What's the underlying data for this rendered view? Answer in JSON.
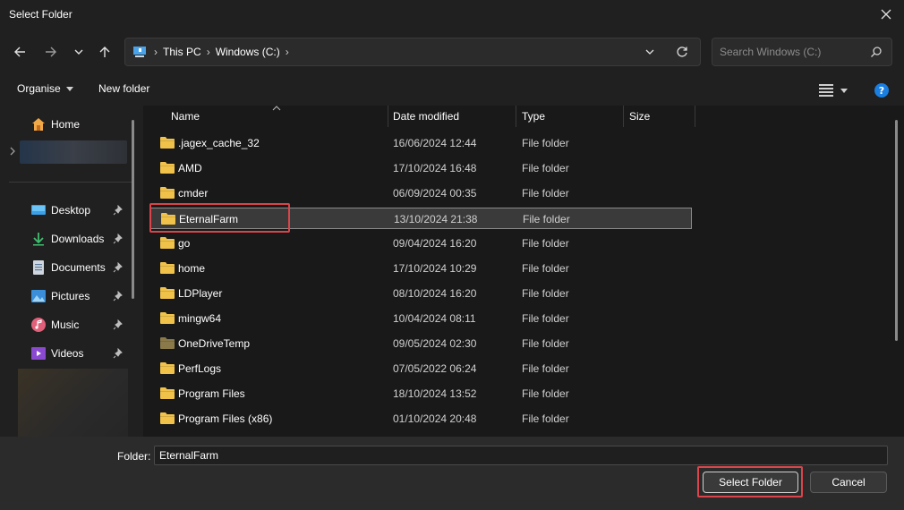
{
  "window": {
    "title": "Select Folder"
  },
  "nav": {
    "breadcrumb": [
      "This PC",
      "Windows (C:)"
    ],
    "search_placeholder": "Search Windows (C:)"
  },
  "toolbar": {
    "organise": "Organise",
    "new_folder": "New folder"
  },
  "sidebar": {
    "home": "Home",
    "pinned": [
      {
        "label": "Desktop",
        "icon": "desktop-icon"
      },
      {
        "label": "Downloads",
        "icon": "downloads-icon"
      },
      {
        "label": "Documents",
        "icon": "documents-icon"
      },
      {
        "label": "Pictures",
        "icon": "pictures-icon"
      },
      {
        "label": "Music",
        "icon": "music-icon"
      },
      {
        "label": "Videos",
        "icon": "videos-icon"
      }
    ]
  },
  "columns": {
    "name": "Name",
    "date": "Date modified",
    "type": "Type",
    "size": "Size"
  },
  "files": [
    {
      "name": ".jagex_cache_32",
      "date": "16/06/2024 12:44",
      "type": "File folder"
    },
    {
      "name": "AMD",
      "date": "17/10/2024 16:48",
      "type": "File folder"
    },
    {
      "name": "cmder",
      "date": "06/09/2024 00:35",
      "type": "File folder"
    },
    {
      "name": "EternalFarm",
      "date": "13/10/2024 21:38",
      "type": "File folder",
      "selected": true
    },
    {
      "name": "go",
      "date": "09/04/2024 16:20",
      "type": "File folder"
    },
    {
      "name": "home",
      "date": "17/10/2024 10:29",
      "type": "File folder"
    },
    {
      "name": "LDPlayer",
      "date": "08/10/2024 16:20",
      "type": "File folder"
    },
    {
      "name": "mingw64",
      "date": "10/04/2024 08:11",
      "type": "File folder"
    },
    {
      "name": "OneDriveTemp",
      "date": "09/05/2024 02:30",
      "type": "File folder",
      "dim": true
    },
    {
      "name": "PerfLogs",
      "date": "07/05/2022 06:24",
      "type": "File folder"
    },
    {
      "name": "Program Files",
      "date": "18/10/2024 13:52",
      "type": "File folder"
    },
    {
      "name": "Program Files (x86)",
      "date": "01/10/2024 20:48",
      "type": "File folder"
    }
  ],
  "footer": {
    "folder_label": "Folder:",
    "folder_value": "EternalFarm",
    "select_button": "Select Folder",
    "cancel_button": "Cancel"
  },
  "colors": {
    "folder": "#f0c24a",
    "folder_dim": "#8a7a4a",
    "highlight": "#d9454a",
    "accent": "#3b8eea"
  }
}
